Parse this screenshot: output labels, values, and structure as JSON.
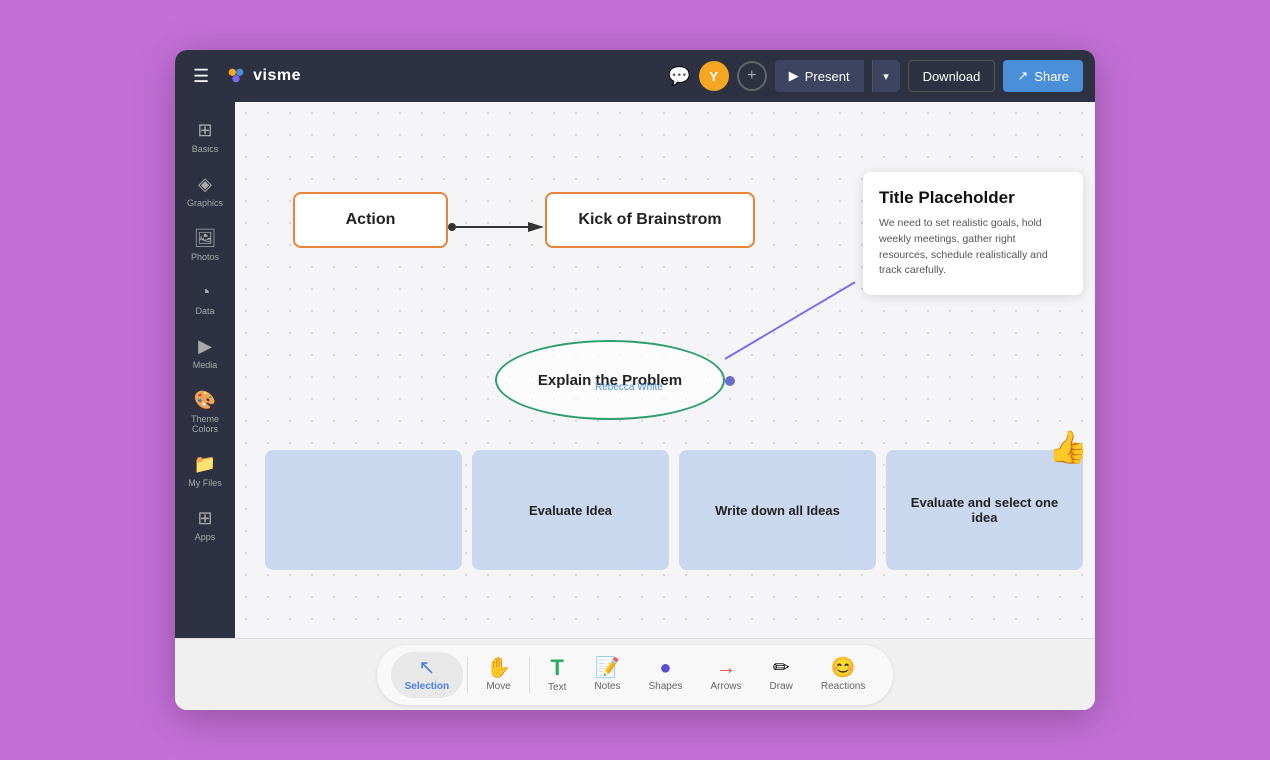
{
  "app": {
    "title": "visme"
  },
  "topbar": {
    "logo_text": "visme",
    "avatar_label": "Y",
    "present_label": "Present",
    "dropdown_icon": "▾",
    "download_label": "Download",
    "share_label": "Share"
  },
  "sidebar": {
    "items": [
      {
        "label": "Basics",
        "icon": "⊞"
      },
      {
        "label": "Graphics",
        "icon": "◈"
      },
      {
        "label": "Photos",
        "icon": "🖼"
      },
      {
        "label": "Data",
        "icon": "◔"
      },
      {
        "label": "Media",
        "icon": "▶"
      },
      {
        "label": "Theme Colors",
        "icon": "🎨"
      },
      {
        "label": "My Files",
        "icon": "📁"
      },
      {
        "label": "Apps",
        "icon": "⊞"
      }
    ]
  },
  "canvas": {
    "shape_action_label": "Action",
    "shape_kick_label": "Kick of Brainstrom",
    "title_card_title": "Title Placeholder",
    "title_card_body": "We need to set realistic goals, hold weekly meetings, gather right resources, schedule realistically and track carefully.",
    "oval_label": "Explain the Problem",
    "oval_user": "Rebecca White",
    "cards": [
      {
        "label": "",
        "empty": true
      },
      {
        "label": "Evaluate Idea"
      },
      {
        "label": "Write down all Ideas"
      },
      {
        "label": "Evaluate and select one idea",
        "thumbs": true
      }
    ]
  },
  "toolbar": {
    "tools": [
      {
        "label": "Selection",
        "icon": "↖",
        "active": true
      },
      {
        "label": "Move",
        "icon": "✋"
      },
      {
        "label": "Text",
        "icon": "T"
      },
      {
        "label": "Notes",
        "icon": "📝"
      },
      {
        "label": "Shapes",
        "icon": "●"
      },
      {
        "label": "Arrows",
        "icon": "→"
      },
      {
        "label": "Draw",
        "icon": "✏"
      },
      {
        "label": "Reactions",
        "icon": "😊"
      }
    ]
  }
}
